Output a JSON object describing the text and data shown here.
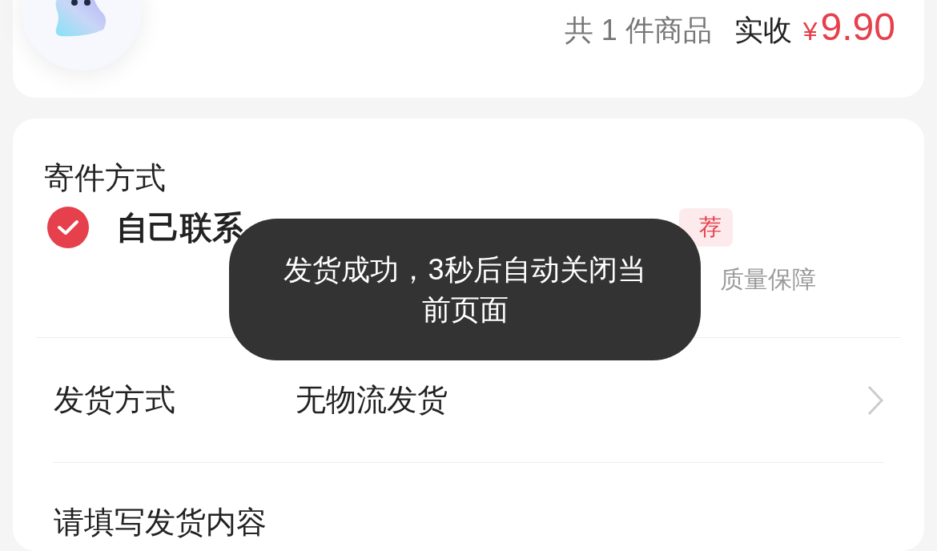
{
  "order_summary": {
    "count_text": "共 1 件商品",
    "received_label": "实收",
    "currency": "¥",
    "amount": "9.90"
  },
  "shipping_method_section": {
    "title": "寄件方式",
    "option": {
      "label": "自己联系",
      "checked": true,
      "badge": "荐",
      "note": "质量保障"
    }
  },
  "delivery": {
    "label": "发货方式",
    "value": "无物流发货"
  },
  "content_prompt": "请填写发货内容",
  "toast": {
    "message": "发货成功，3秒后自动关闭当前页面"
  }
}
